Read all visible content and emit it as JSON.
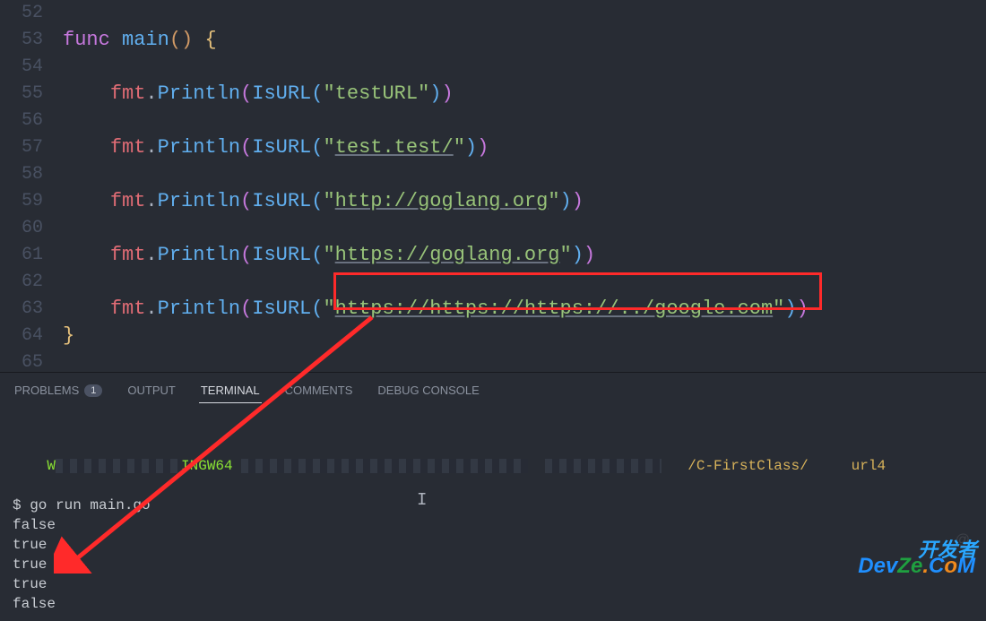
{
  "gutter": {
    "start": 52,
    "end": 65
  },
  "code": {
    "l53": {
      "func": "func",
      "main": "main",
      "paren": "()",
      "brace": "{"
    },
    "l55": {
      "fmt": "fmt",
      "println": "Println",
      "isurl": "IsURL",
      "str": "\"testURL\""
    },
    "l57": {
      "fmt": "fmt",
      "println": "Println",
      "isurl": "IsURL",
      "strq": "\"",
      "url": "test.test/",
      "strq2": "\""
    },
    "l59": {
      "fmt": "fmt",
      "println": "Println",
      "isurl": "IsURL",
      "strq": "\"",
      "url": "http://goglang.org",
      "strq2": "\""
    },
    "l61": {
      "fmt": "fmt",
      "println": "Println",
      "isurl": "IsURL",
      "strq": "\"",
      "url": "https://goglang.org",
      "strq2": "\""
    },
    "l63": {
      "fmt": "fmt",
      "println": "Println",
      "isurl": "IsURL",
      "strq": "\"",
      "url": "https://https://https://../google.com",
      "strq2": "\""
    },
    "l64": {
      "brace": "}"
    }
  },
  "tabs": {
    "problems": "PROBLEMS",
    "problems_count": "1",
    "output": "OUTPUT",
    "terminal": "TERMINAL",
    "comments": "COMMENTS",
    "debug": "DEBUG CONSOLE"
  },
  "terminal": {
    "prompt_pre": "W",
    "prompt_host": "INGW64",
    "path_tail": "/C-FirstClass/     url4",
    "cmd": "$ go run main.go",
    "out1": "false",
    "out2": "true",
    "out3": "true",
    "out4": "true",
    "out5": "false"
  },
  "watermark": {
    "attr": "@",
    "brand": "DevZe.CoM",
    "kaifa": "开发者"
  }
}
